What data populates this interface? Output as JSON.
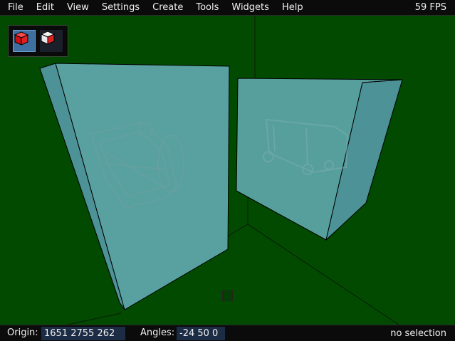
{
  "menu": {
    "items": [
      "File",
      "Edit",
      "View",
      "Settings",
      "Create",
      "Tools",
      "Widgets",
      "Help"
    ],
    "fps": "59 FPS"
  },
  "toolbox": {
    "tools": [
      {
        "icon": "red-cube-icon",
        "active": true
      },
      {
        "icon": "red-white-cube-icon",
        "active": false
      }
    ]
  },
  "viewport": {
    "background_color": "#014a00",
    "box_color": "#6fb4c0"
  },
  "status": {
    "origin_label": "Origin:",
    "origin_value": "1651 2755 262",
    "angles_label": "Angles:",
    "angles_value": "-24 50 0",
    "selection": "no selection"
  }
}
